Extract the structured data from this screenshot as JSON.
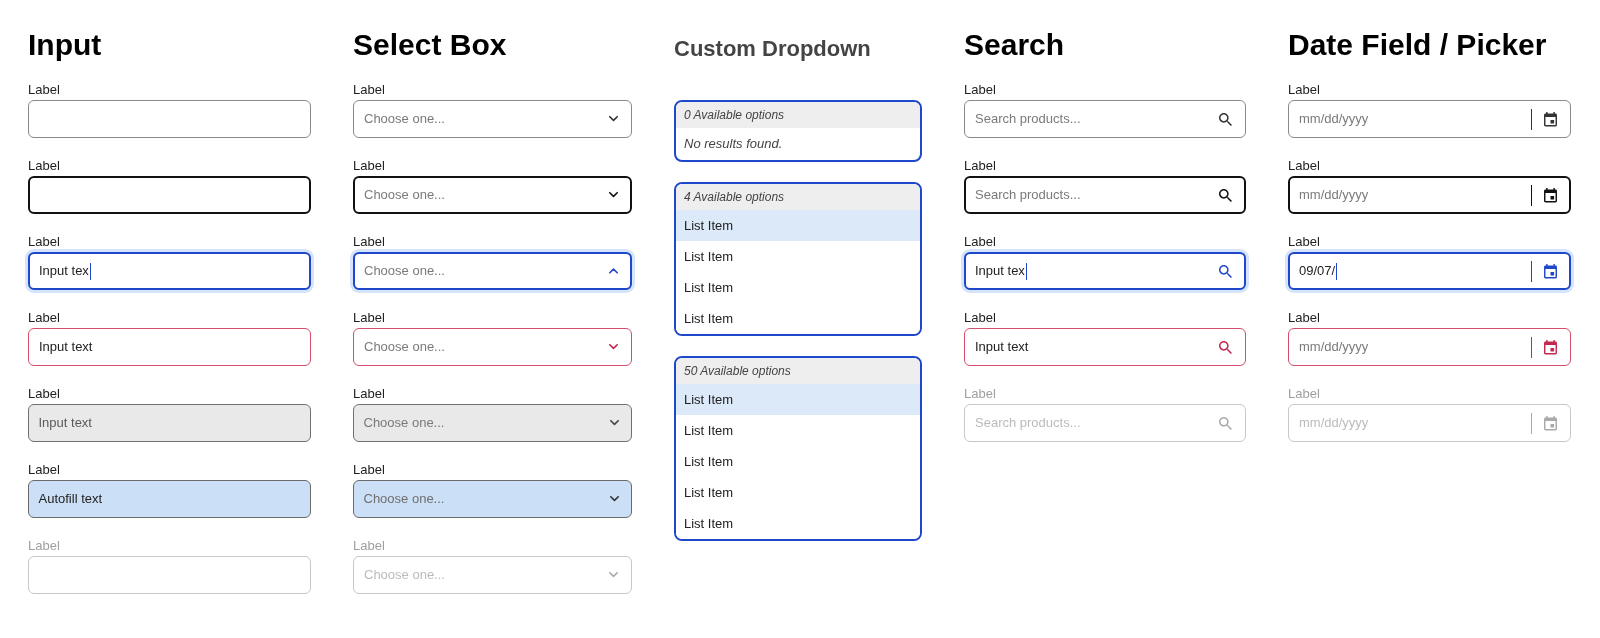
{
  "columns": [
    {
      "kind": "input",
      "title": "Input",
      "fields": [
        {
          "label": "Label",
          "hovered": false,
          "focused": false,
          "error": false,
          "read_only": false,
          "autofilled": false,
          "disabled": false
        },
        {
          "label": "Label",
          "hovered": true,
          "focused": false,
          "error": false,
          "read_only": false,
          "autofilled": false,
          "disabled": false
        },
        {
          "label": "Label",
          "value": "Input tex",
          "hovered": false,
          "focused": true,
          "error": false,
          "read_only": false,
          "autofilled": false,
          "disabled": false
        },
        {
          "label": "Label",
          "value": "Input text",
          "hovered": false,
          "focused": false,
          "error": true,
          "read_only": false,
          "autofilled": false,
          "disabled": false
        },
        {
          "label": "Label",
          "value": "Input text",
          "hovered": false,
          "focused": false,
          "error": false,
          "read_only": true,
          "autofilled": false,
          "disabled": false
        },
        {
          "label": "Label",
          "value": "Autofill text",
          "hovered": false,
          "focused": false,
          "error": false,
          "read_only": false,
          "autofilled": true,
          "disabled": false
        },
        {
          "label": "Label",
          "hovered": false,
          "focused": false,
          "error": false,
          "read_only": false,
          "autofilled": false,
          "disabled": true
        }
      ]
    },
    {
      "kind": "select",
      "title": "Select Box",
      "fields": [
        {
          "label": "Label",
          "placeholder": "Choose one...",
          "hovered": false,
          "focused": false,
          "error": false,
          "read_only": false,
          "autofilled": false,
          "disabled": false
        },
        {
          "label": "Label",
          "placeholder": "Choose one...",
          "hovered": true,
          "focused": false,
          "error": false,
          "read_only": false,
          "autofilled": false,
          "disabled": false
        },
        {
          "label": "Label",
          "placeholder": "Choose one...",
          "hovered": false,
          "focused": true,
          "error": false,
          "read_only": false,
          "autofilled": false,
          "disabled": false
        },
        {
          "label": "Label",
          "placeholder": "Choose one...",
          "hovered": false,
          "focused": false,
          "error": true,
          "read_only": false,
          "autofilled": false,
          "disabled": false
        },
        {
          "label": "Label",
          "placeholder": "Choose one...",
          "hovered": false,
          "focused": false,
          "error": false,
          "read_only": true,
          "autofilled": false,
          "disabled": false
        },
        {
          "label": "Label",
          "placeholder": "Choose one...",
          "hovered": false,
          "focused": false,
          "error": false,
          "read_only": false,
          "autofilled": true,
          "disabled": false
        },
        {
          "label": "Label",
          "placeholder": "Choose one...",
          "hovered": false,
          "focused": false,
          "error": false,
          "read_only": false,
          "autofilled": false,
          "disabled": true
        }
      ]
    },
    {
      "kind": "dropdown",
      "title": "Custom Dropdown",
      "panels": [
        {
          "header": "0 Available options",
          "empty_text": "No results found."
        },
        {
          "header": "4 Available options",
          "items": [
            {
              "label": "List Item",
              "selected": true
            },
            {
              "label": "List Item",
              "selected": false
            },
            {
              "label": "List Item",
              "selected": false
            },
            {
              "label": "List Item",
              "selected": false
            }
          ]
        },
        {
          "header": "50 Available options",
          "items": [
            {
              "label": "List Item",
              "selected": true
            },
            {
              "label": "List Item",
              "selected": false
            },
            {
              "label": "List Item",
              "selected": false
            },
            {
              "label": "List Item",
              "selected": false
            },
            {
              "label": "List Item",
              "selected": false
            }
          ]
        }
      ]
    },
    {
      "kind": "search",
      "title": "Search",
      "fields": [
        {
          "label": "Label",
          "placeholder": "Search products...",
          "hovered": false,
          "focused": false,
          "error": false,
          "read_only": false,
          "autofilled": false,
          "disabled": false
        },
        {
          "label": "Label",
          "placeholder": "Search products...",
          "hovered": true,
          "focused": false,
          "error": false,
          "read_only": false,
          "autofilled": false,
          "disabled": false
        },
        {
          "label": "Label",
          "value": "Input tex",
          "hovered": false,
          "focused": true,
          "error": false,
          "read_only": false,
          "autofilled": false,
          "disabled": false
        },
        {
          "label": "Label",
          "value": "Input text",
          "hovered": false,
          "focused": false,
          "error": true,
          "read_only": false,
          "autofilled": false,
          "disabled": false
        },
        {
          "label": "Label",
          "placeholder": "Search products...",
          "hovered": false,
          "focused": false,
          "error": false,
          "read_only": false,
          "autofilled": false,
          "disabled": true
        }
      ]
    },
    {
      "kind": "date",
      "title": "Date Field / Picker",
      "fields": [
        {
          "label": "Label",
          "placeholder": "mm/dd/yyyy",
          "hovered": false,
          "focused": false,
          "error": false,
          "read_only": false,
          "autofilled": false,
          "disabled": false
        },
        {
          "label": "Label",
          "placeholder": "mm/dd/yyyy",
          "hovered": true,
          "focused": false,
          "error": false,
          "read_only": false,
          "autofilled": false,
          "disabled": false
        },
        {
          "label": "Label",
          "value": "09/07/",
          "hovered": false,
          "focused": true,
          "error": false,
          "read_only": false,
          "autofilled": false,
          "disabled": false
        },
        {
          "label": "Label",
          "placeholder": "mm/dd/yyyy",
          "hovered": false,
          "focused": false,
          "error": true,
          "read_only": false,
          "autofilled": false,
          "disabled": false
        },
        {
          "label": "Label",
          "placeholder": "mm/dd/yyyy",
          "hovered": false,
          "focused": false,
          "error": false,
          "read_only": false,
          "autofilled": false,
          "disabled": true
        }
      ]
    }
  ]
}
